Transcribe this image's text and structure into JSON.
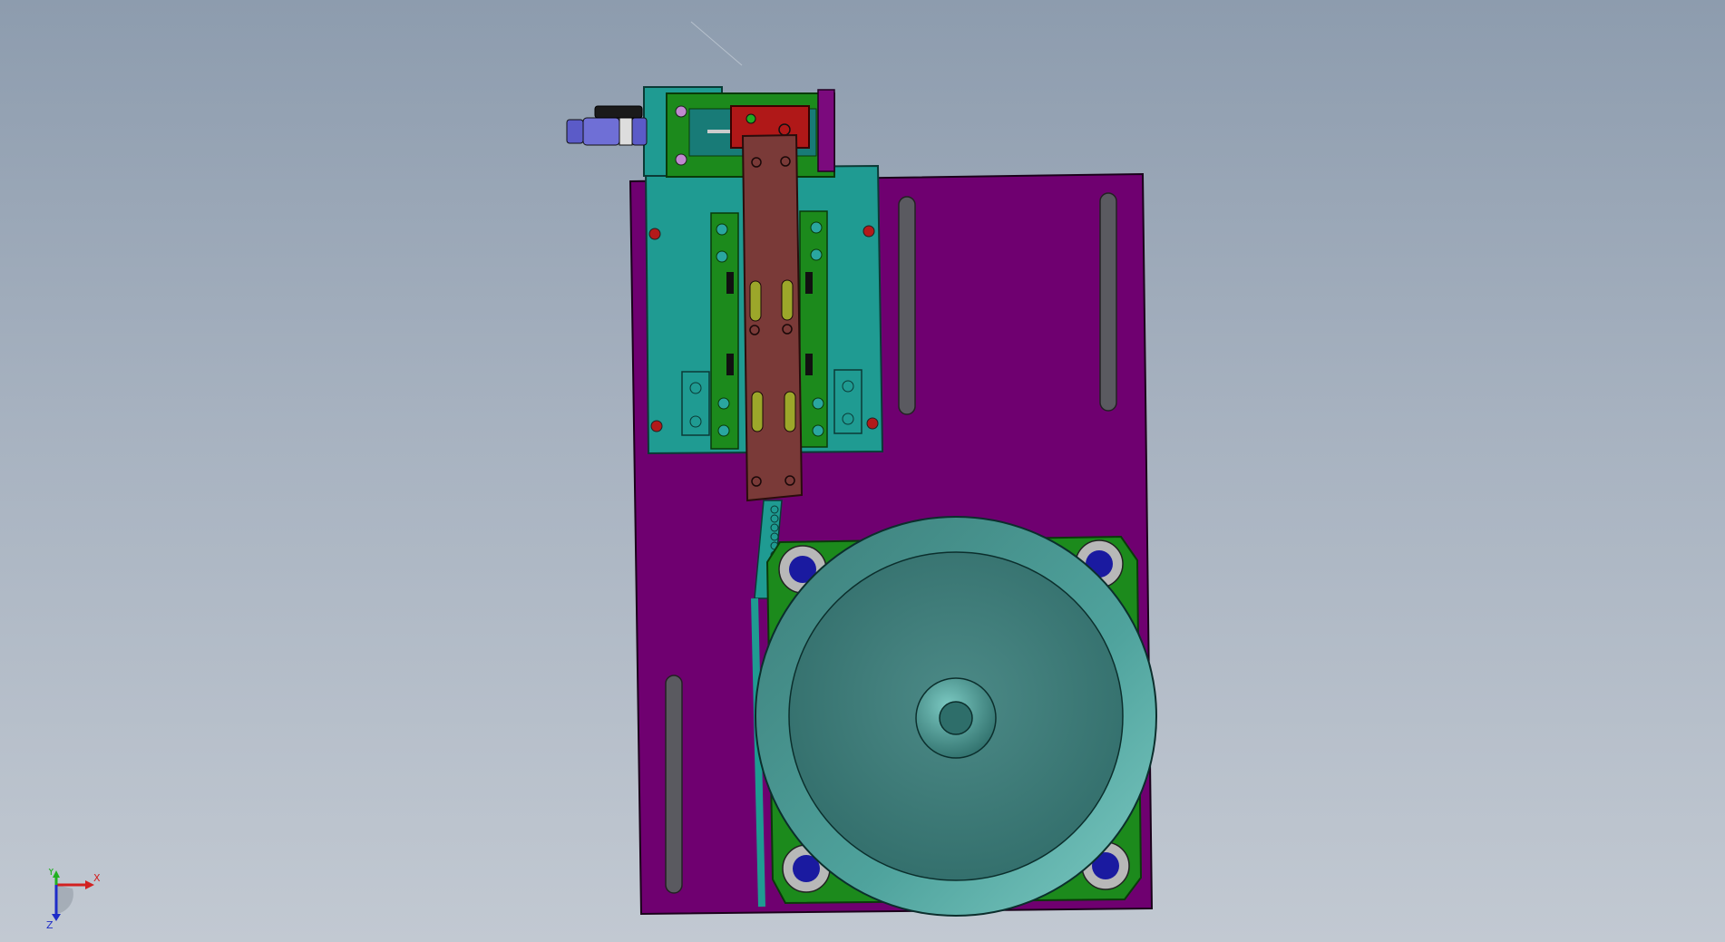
{
  "viewport": {
    "background_top": "#8d9cae",
    "background_bottom": "#c2c9d2"
  },
  "triad": {
    "x_label": "X",
    "y_label": "Y",
    "z_label": "Z",
    "x_color": "#d22020",
    "y_color": "#20b020",
    "z_color": "#1e2cc8"
  },
  "model": {
    "plate_color": "#6f0070",
    "teal_color": "#1f9b92",
    "green_color": "#1c8a1c",
    "red_color": "#b01818",
    "brown_color": "#7a3a38",
    "bowl_color": "#3f7c7a",
    "rim_color": "#5fb3ad",
    "bolt_color": "#1a1aa0",
    "cylinder_color": "#5b5bc8"
  }
}
